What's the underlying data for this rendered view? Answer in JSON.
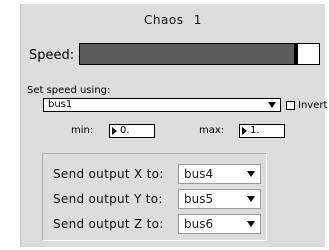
{
  "window": {
    "title": "Chaos  1"
  },
  "speed": {
    "label": "Speed:",
    "level": 0.905
  },
  "set_speed": {
    "label": "Set speed using:",
    "bus_value": "bus1",
    "invert_label": "Invert",
    "invert_checked": false,
    "min_label": "min:",
    "min_value": "0.",
    "max_label": "max:",
    "max_value": "1."
  },
  "outputs": [
    {
      "label": "Send output X to:",
      "value": "bus4"
    },
    {
      "label": "Send output Y to:",
      "value": "bus5"
    },
    {
      "label": "Send output Z to:",
      "value": "bus6"
    }
  ],
  "colors": {
    "panel_bg": "#dcdcdc",
    "speed_fill": "#5c5c5c"
  }
}
